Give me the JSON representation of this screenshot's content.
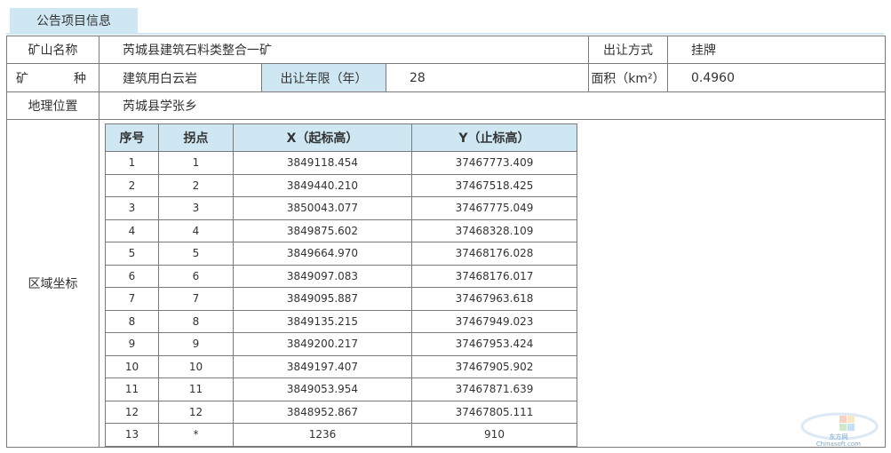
{
  "section_tab": "公告项目信息",
  "info": {
    "mine_name_label": "矿山名称",
    "mine_name": "芮城县建筑石料类整合一矿",
    "transfer_method_label": "出让方式",
    "transfer_method": "挂牌",
    "mineral_label_1": "矿",
    "mineral_label_2": "种",
    "mineral": "建筑用白云岩",
    "term_label": "出让年限（年）",
    "term": "28",
    "area_label": "面积（km²）",
    "area": "0.4960",
    "location_label": "地理位置",
    "location": "芮城县学张乡",
    "region_label": "区域坐标"
  },
  "coordinates": {
    "headers": [
      "序号",
      "拐点",
      "X（起标高）",
      "Y（止标高）"
    ],
    "rows": [
      [
        "1",
        "1",
        "3849118.454",
        "37467773.409"
      ],
      [
        "2",
        "2",
        "3849440.210",
        "37467518.425"
      ],
      [
        "3",
        "3",
        "3850043.077",
        "37467775.049"
      ],
      [
        "4",
        "4",
        "3849875.602",
        "37468328.109"
      ],
      [
        "5",
        "5",
        "3849664.970",
        "37468176.028"
      ],
      [
        "6",
        "6",
        "3849097.083",
        "37468176.017"
      ],
      [
        "7",
        "7",
        "3849095.887",
        "37467963.618"
      ],
      [
        "8",
        "8",
        "3849135.215",
        "37467949.023"
      ],
      [
        "9",
        "9",
        "3849200.217",
        "37467953.424"
      ],
      [
        "10",
        "10",
        "3849197.407",
        "37467905.902"
      ],
      [
        "11",
        "11",
        "3849053.954",
        "37467871.639"
      ],
      [
        "12",
        "12",
        "3848952.867",
        "37467805.111"
      ],
      [
        "13",
        "*",
        "1236",
        "910"
      ]
    ]
  },
  "watermark": {
    "line1": "东方网",
    "line2": "Chinasoft.com"
  },
  "colors": {
    "header_bg": "#cfe7f3",
    "border": "#7a7a7a"
  }
}
